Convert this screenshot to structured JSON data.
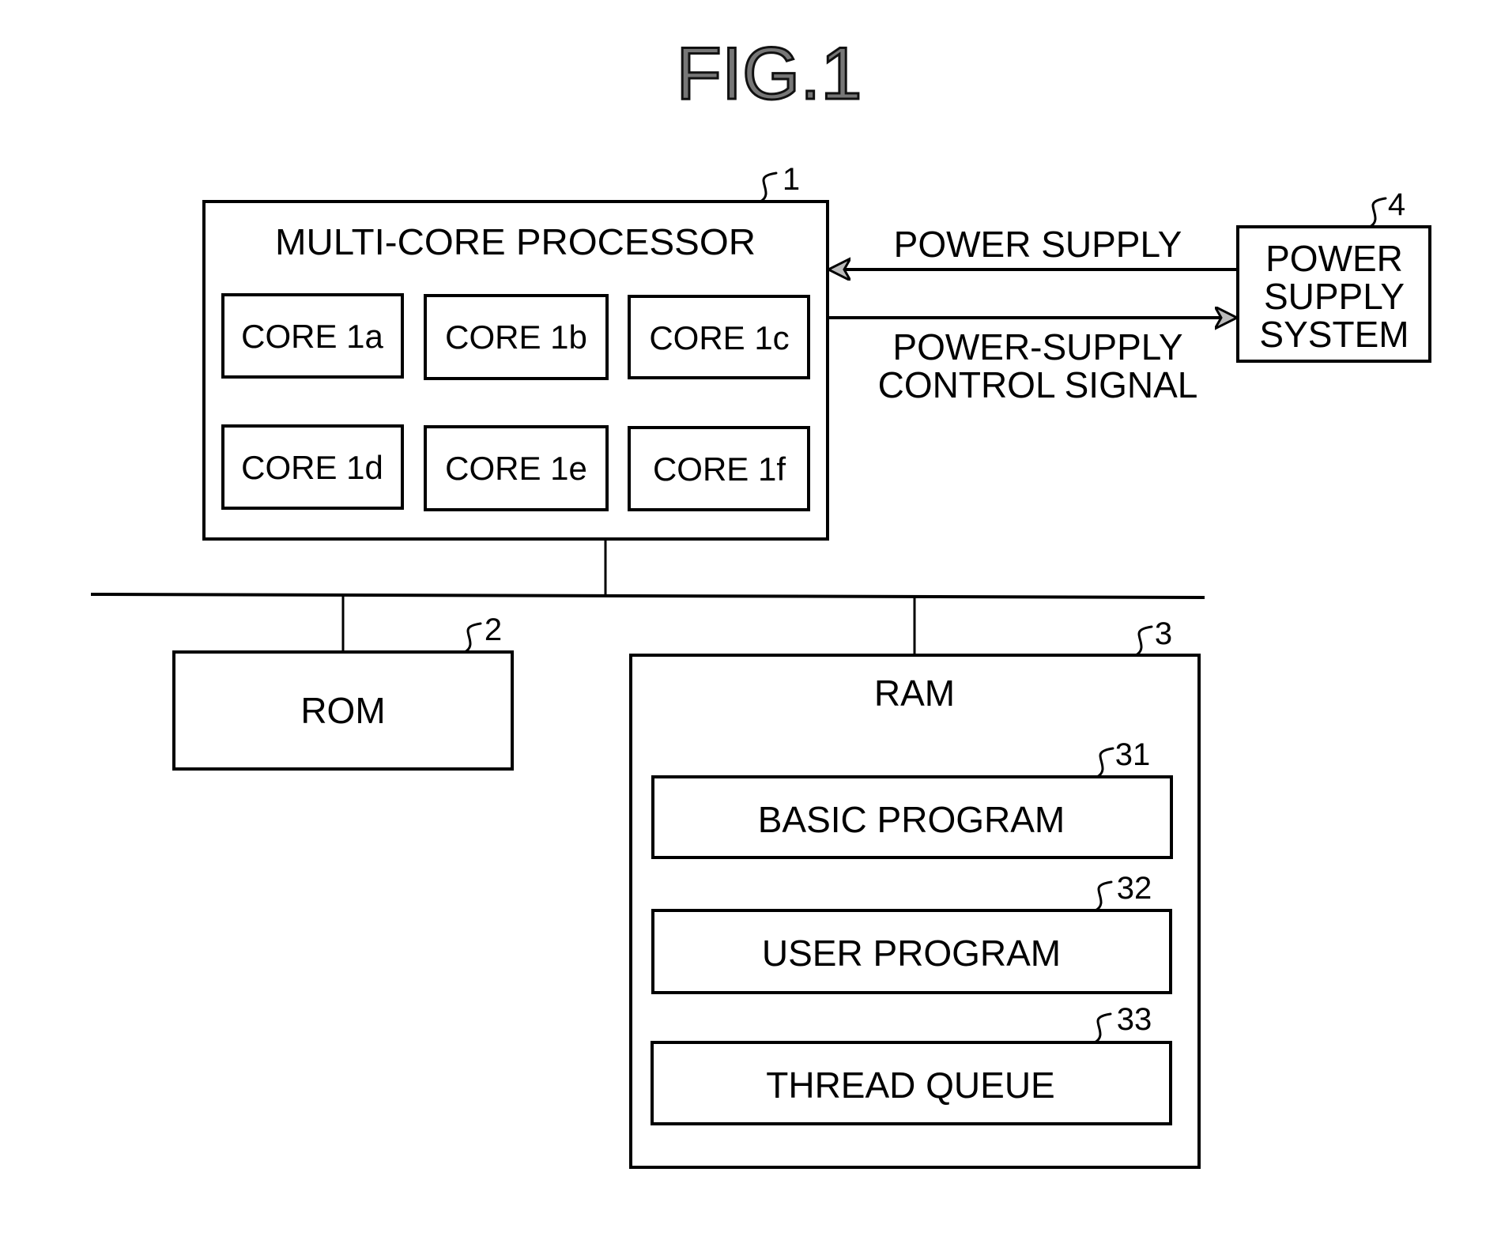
{
  "figure": {
    "title": "FIG.1"
  },
  "processor": {
    "ref": "1",
    "label": "MULTI-CORE PROCESSOR",
    "cores": [
      {
        "label": "CORE 1a"
      },
      {
        "label": "CORE 1b"
      },
      {
        "label": "CORE 1c"
      },
      {
        "label": "CORE 1d"
      },
      {
        "label": "CORE 1e"
      },
      {
        "label": "CORE 1f"
      }
    ]
  },
  "power_supply_system": {
    "ref": "4",
    "label_lines": [
      "POWER",
      "SUPPLY",
      "SYSTEM"
    ]
  },
  "signals": {
    "power_supply": "POWER SUPPLY",
    "control_signal_lines": [
      "POWER-SUPPLY",
      "CONTROL SIGNAL"
    ]
  },
  "rom": {
    "ref": "2",
    "label": "ROM"
  },
  "ram": {
    "ref": "3",
    "label": "RAM",
    "contents": [
      {
        "ref": "31",
        "label": "BASIC PROGRAM"
      },
      {
        "ref": "32",
        "label": "USER PROGRAM"
      },
      {
        "ref": "33",
        "label": "THREAD QUEUE"
      }
    ]
  }
}
